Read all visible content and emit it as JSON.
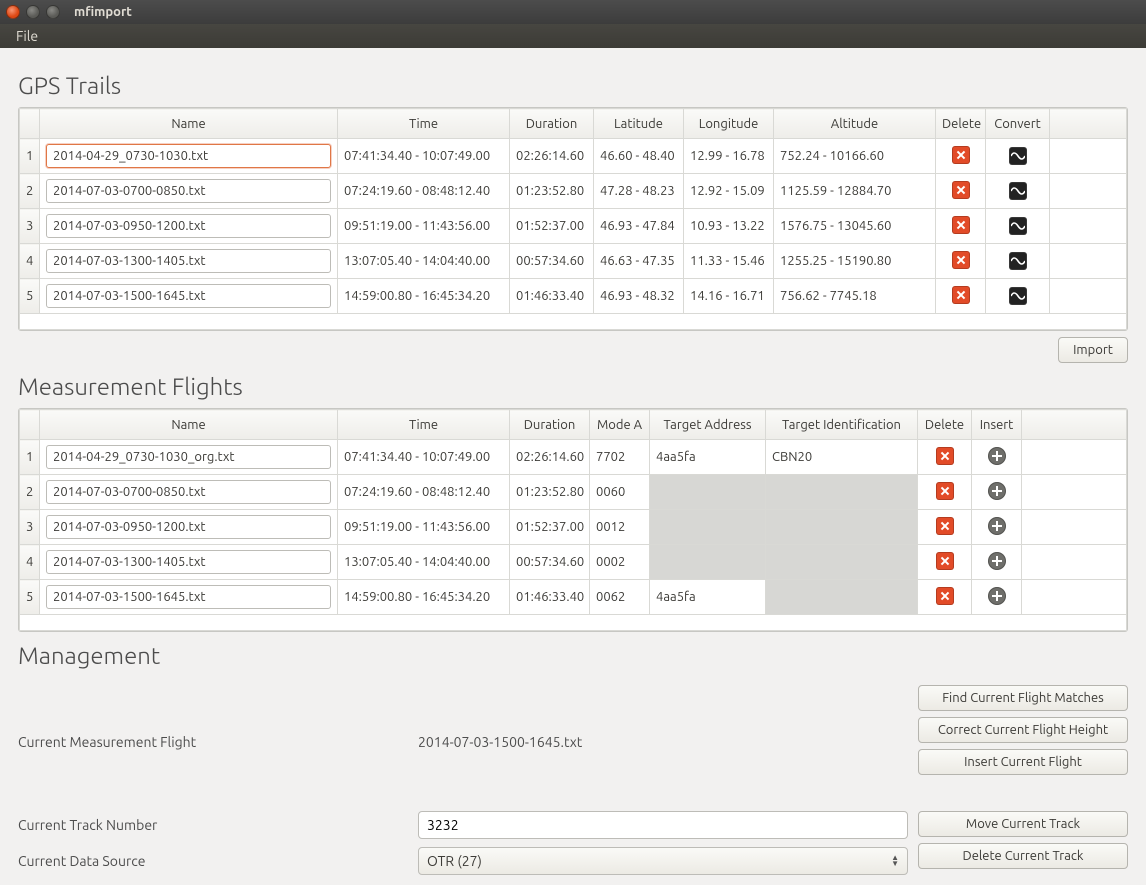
{
  "window": {
    "title": "mfimport"
  },
  "menubar": {
    "file": "File"
  },
  "sections": {
    "gps_title": "GPS Trails",
    "flights_title": "Measurement Flights",
    "mgmt_title": "Management"
  },
  "gps": {
    "headers": [
      "",
      "Name",
      "Time",
      "Duration",
      "Latitude",
      "Longitude",
      "Altitude",
      "Delete",
      "Convert"
    ],
    "rows": [
      {
        "n": "1",
        "name": "2014-04-29_0730-1030.txt",
        "time": "07:41:34.40 - 10:07:49.00",
        "dur": "02:26:14.60",
        "lat": "46.60 - 48.40",
        "lon": "12.99 - 16.78",
        "alt": "752.24 - 10166.60"
      },
      {
        "n": "2",
        "name": "2014-07-03-0700-0850.txt",
        "time": "07:24:19.60 - 08:48:12.40",
        "dur": "01:23:52.80",
        "lat": "47.28 - 48.23",
        "lon": "12.92 - 15.09",
        "alt": "1125.59 - 12884.70"
      },
      {
        "n": "3",
        "name": "2014-07-03-0950-1200.txt",
        "time": "09:51:19.00 - 11:43:56.00",
        "dur": "01:52:37.00",
        "lat": "46.93 - 47.84",
        "lon": "10.93 - 13.22",
        "alt": "1576.75 - 13045.60"
      },
      {
        "n": "4",
        "name": "2014-07-03-1300-1405.txt",
        "time": "13:07:05.40 - 14:04:40.00",
        "dur": "00:57:34.60",
        "lat": "46.63 - 47.35",
        "lon": "11.33 - 15.46",
        "alt": "1255.25 - 15190.80"
      },
      {
        "n": "5",
        "name": "2014-07-03-1500-1645.txt",
        "time": "14:59:00.80 - 16:45:34.20",
        "dur": "01:46:33.40",
        "lat": "46.93 - 48.32",
        "lon": "14.16 - 16.71",
        "alt": "756.62 - 7745.18"
      }
    ]
  },
  "flights": {
    "headers": [
      "",
      "Name",
      "Time",
      "Duration",
      "Mode A",
      "Target Address",
      "Target Identification",
      "Delete",
      "Insert"
    ],
    "rows": [
      {
        "n": "1",
        "name": "2014-04-29_0730-1030_org.txt",
        "time": "07:41:34.40 - 10:07:49.00",
        "dur": "02:26:14.60",
        "mode": "7702",
        "addr": "4aa5fa",
        "ident": "CBN20"
      },
      {
        "n": "2",
        "name": "2014-07-03-0700-0850.txt",
        "time": "07:24:19.60 - 08:48:12.40",
        "dur": "01:23:52.80",
        "mode": "0060",
        "addr": "",
        "ident": ""
      },
      {
        "n": "3",
        "name": "2014-07-03-0950-1200.txt",
        "time": "09:51:19.00 - 11:43:56.00",
        "dur": "01:52:37.00",
        "mode": "0012",
        "addr": "",
        "ident": ""
      },
      {
        "n": "4",
        "name": "2014-07-03-1300-1405.txt",
        "time": "13:07:05.40 - 14:04:40.00",
        "dur": "00:57:34.60",
        "mode": "0002",
        "addr": "",
        "ident": ""
      },
      {
        "n": "5",
        "name": "2014-07-03-1500-1645.txt",
        "time": "14:59:00.80 - 16:45:34.20",
        "dur": "01:46:33.40",
        "mode": "0062",
        "addr": "4aa5fa",
        "ident": ""
      }
    ]
  },
  "buttons": {
    "import": "Import",
    "find_matches": "Find Current Flight Matches",
    "correct_height": "Correct Current Flight Height",
    "insert_flight": "Insert Current Flight",
    "move_track": "Move Current Track",
    "delete_track": "Delete Current Track"
  },
  "mgmt": {
    "curr_flight_label": "Current Measurement Flight",
    "curr_flight_value": "2014-07-03-1500-1645.txt",
    "track_num_label": "Current Track Number",
    "track_num_value": "3232",
    "data_source_label": "Current Data Source",
    "data_source_value": "OTR (27)"
  }
}
